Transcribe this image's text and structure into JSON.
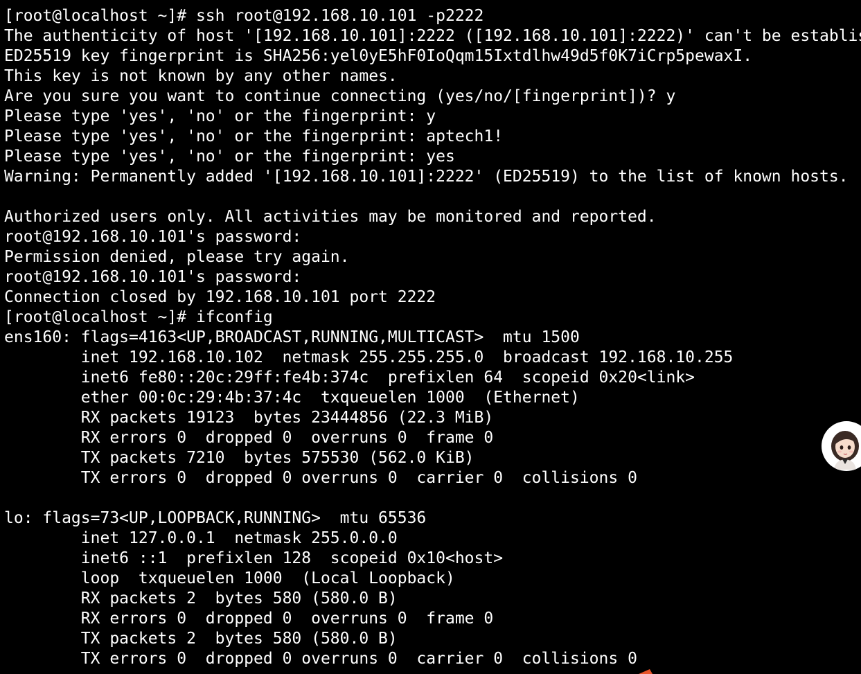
{
  "terminal": {
    "lines": [
      "[root@localhost ~]# ssh root@192.168.10.101 -p2222",
      "The authenticity of host '[192.168.10.101]:2222 ([192.168.10.101]:2222)' can't be established.",
      "ED25519 key fingerprint is SHA256:yel0yE5hF0IoQqm15Ixtdlhw49d5f0K7iCrp5pewaxI.",
      "This key is not known by any other names.",
      "Are you sure you want to continue connecting (yes/no/[fingerprint])? y",
      "Please type 'yes', 'no' or the fingerprint: y",
      "Please type 'yes', 'no' or the fingerprint: aptech1!",
      "Please type 'yes', 'no' or the fingerprint: yes",
      "Warning: Permanently added '[192.168.10.101]:2222' (ED25519) to the list of known hosts.",
      "",
      "Authorized users only. All activities may be monitored and reported.",
      "root@192.168.10.101's password:",
      "Permission denied, please try again.",
      "root@192.168.10.101's password:",
      "Connection closed by 192.168.10.101 port 2222",
      "[root@localhost ~]# ifconfig",
      "ens160: flags=4163<UP,BROADCAST,RUNNING,MULTICAST>  mtu 1500",
      "        inet 192.168.10.102  netmask 255.255.255.0  broadcast 192.168.10.255",
      "        inet6 fe80::20c:29ff:fe4b:374c  prefixlen 64  scopeid 0x20<link>",
      "        ether 00:0c:29:4b:37:4c  txqueuelen 1000  (Ethernet)",
      "        RX packets 19123  bytes 23444856 (22.3 MiB)",
      "        RX errors 0  dropped 0  overruns 0  frame 0",
      "        TX packets 7210  bytes 575530 (562.0 KiB)",
      "        TX errors 0  dropped 0 overruns 0  carrier 0  collisions 0",
      "",
      "lo: flags=73<UP,LOOPBACK,RUNNING>  mtu 65536",
      "        inet 127.0.0.1  netmask 255.0.0.0",
      "        inet6 ::1  prefixlen 128  scopeid 0x10<host>",
      "        loop  txqueuelen 1000  (Local Loopback)",
      "        RX packets 2  bytes 580 (580.0 B)",
      "        RX errors 0  dropped 0  overruns 0  frame 0",
      "        TX packets 2  bytes 580 (580.0 B)",
      "        TX errors 0  dropped 0 overruns 0  carrier 0  collisions 0"
    ]
  },
  "colors": {
    "background": "#000000",
    "foreground": "#ffffff"
  },
  "overlay": {
    "avatar_icon": "assistant-avatar-icon"
  }
}
